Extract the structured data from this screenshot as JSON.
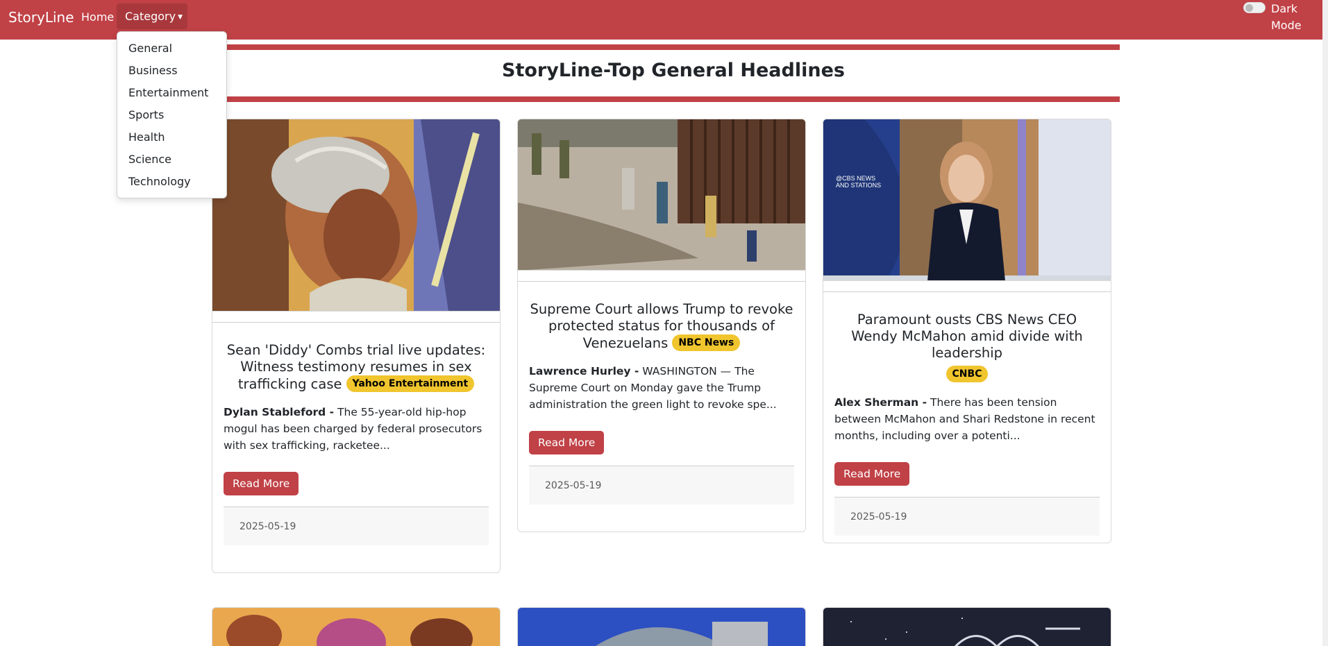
{
  "navbar": {
    "brand": "StoryLine",
    "home": "Home",
    "category": "Category",
    "dark_mode_label": "Dark Mode"
  },
  "dropdown": {
    "items": [
      "General",
      "Business",
      "Entertainment",
      "Sports",
      "Health",
      "Science",
      "Technology"
    ]
  },
  "page": {
    "title": "StoryLine-Top General Headlines"
  },
  "articles": [
    {
      "title": "Sean 'Diddy' Combs trial live updates: Witness testimony resumes in sex trafficking case",
      "source": "Yahoo Entertainment",
      "author": "Dylan Stableford -",
      "description": "The 55-year-old hip-hop mogul has been charged by federal prosecutors with sex trafficking, racketee...",
      "button": "Read More",
      "date": "2025-05-19"
    },
    {
      "title": "Supreme Court allows Trump to revoke protected status for thousands of Venezuelans",
      "source": "NBC News",
      "author": "Lawrence Hurley -",
      "description": "WASHINGTON — The Supreme Court on Monday gave the Trump administration the green light to revoke spe...",
      "button": "Read More",
      "date": "2025-05-19"
    },
    {
      "title": "Paramount ousts CBS News CEO Wendy McMahon amid divide with leadership",
      "source": "CNBC",
      "author": "Alex Sherman -",
      "description": "There has been tension between McMahon and Shari Redstone in recent months, including over a potenti...",
      "button": "Read More",
      "date": "2025-05-19"
    }
  ],
  "colors": {
    "primary": "#c04146",
    "badge": "#f0c52e"
  }
}
